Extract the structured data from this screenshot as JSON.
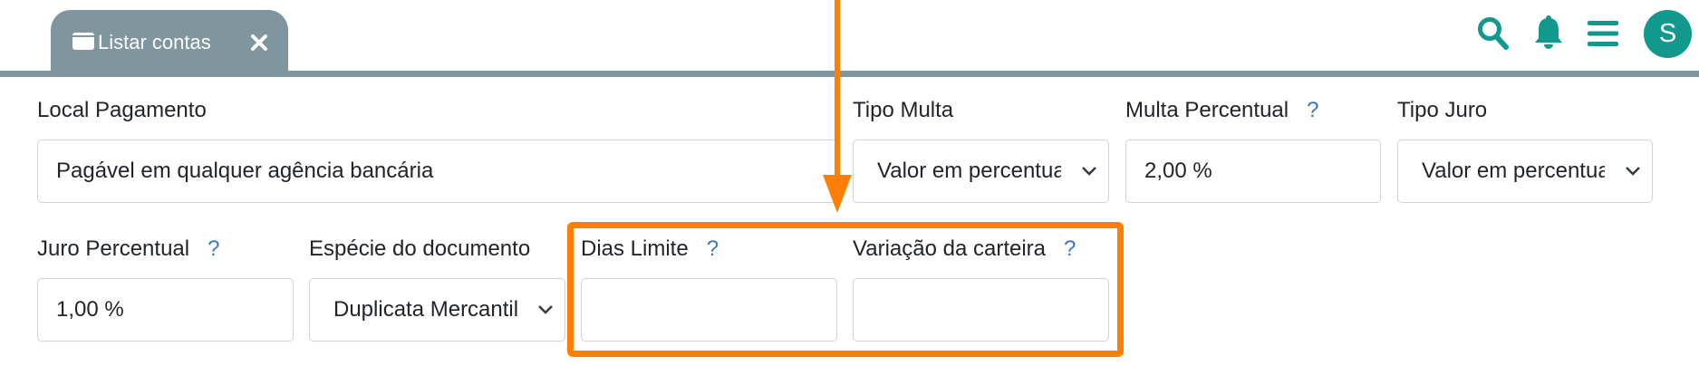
{
  "tab": {
    "label": "Listar contas",
    "icon": "wallet-icon",
    "close_icon": "close-icon"
  },
  "header": {
    "avatar_initial": "S",
    "icons": [
      "search-icon",
      "bell-icon",
      "menu-icon"
    ],
    "accent_color": "#11998e"
  },
  "form": {
    "local_pagamento": {
      "label": "Local Pagamento",
      "value": "Pagável em qualquer agência bancária"
    },
    "tipo_multa": {
      "label": "Tipo Multa",
      "value": "Valor em percentual"
    },
    "multa_percentual": {
      "label": "Multa Percentual",
      "help": "?",
      "value": "2,00 %"
    },
    "tipo_juro": {
      "label": "Tipo Juro",
      "value": "Valor em percentual"
    },
    "juro_percentual": {
      "label": "Juro Percentual",
      "help": "?",
      "value": "1,00 %"
    },
    "especie_documento": {
      "label": "Espécie do documento",
      "value": "Duplicata Mercantil"
    },
    "dias_limite": {
      "label": "Dias Limite",
      "help": "?",
      "value": ""
    },
    "variacao_carteira": {
      "label": "Variação da carteira",
      "help": "?",
      "value": ""
    }
  },
  "annotation": {
    "color": "#ff7f06"
  }
}
